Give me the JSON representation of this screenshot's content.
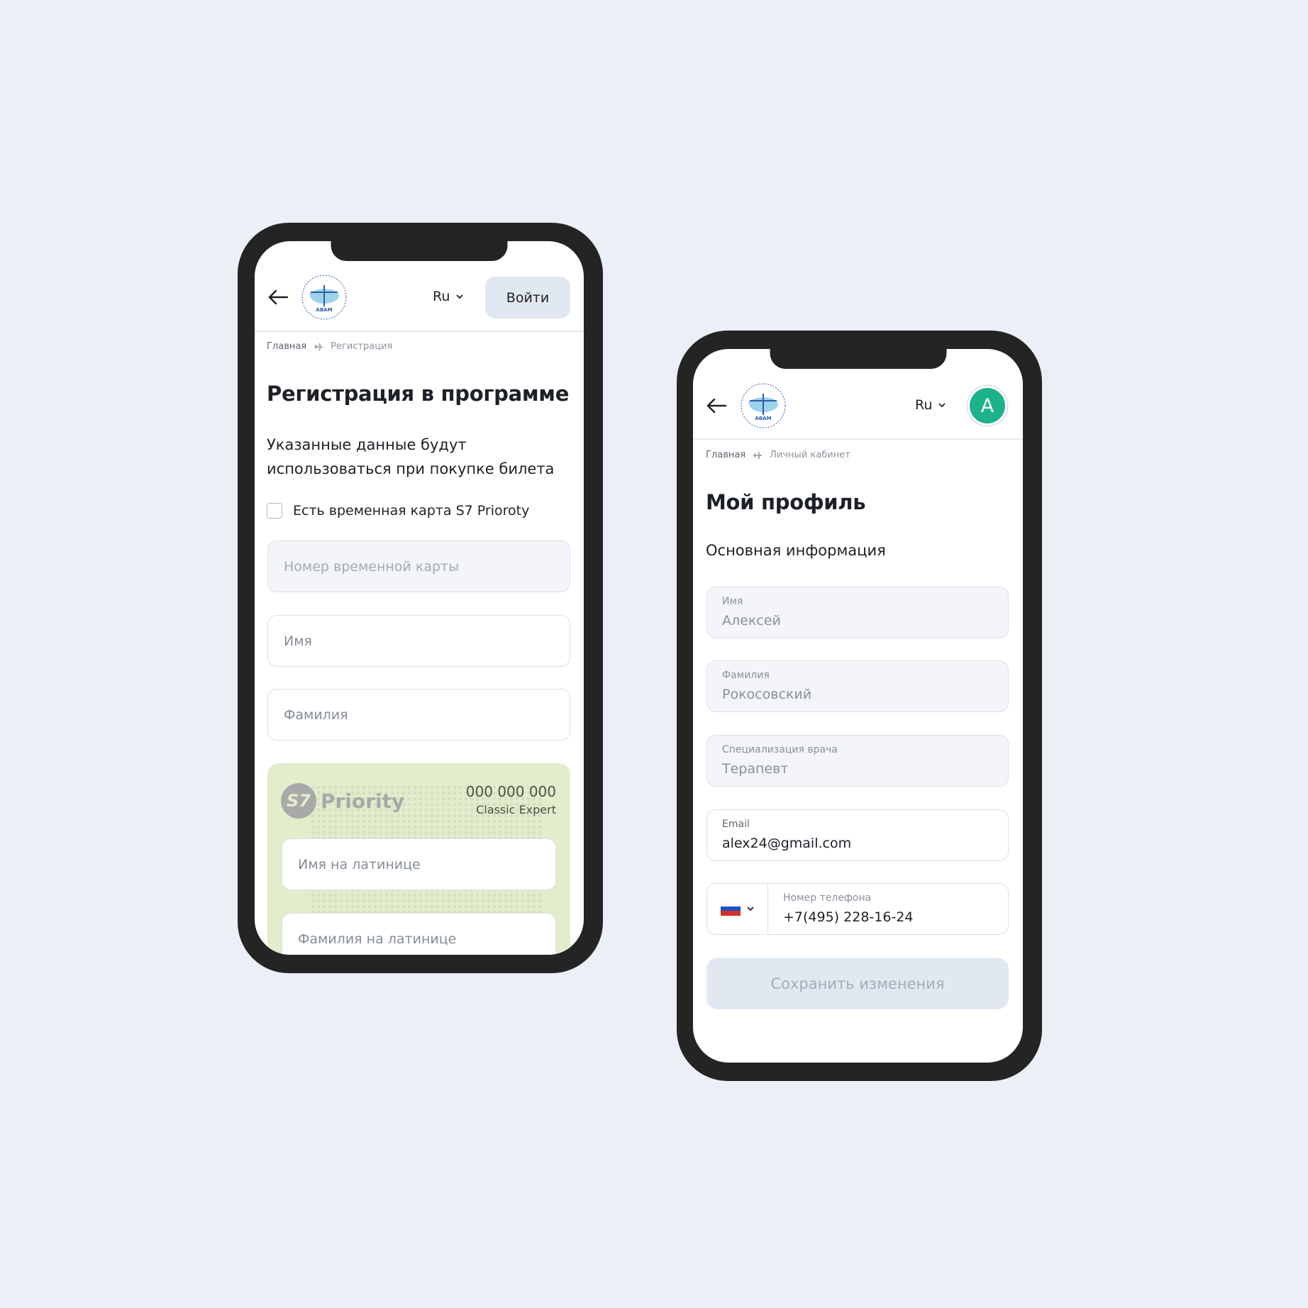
{
  "colors": {
    "background": "#ebeff6",
    "phone_frame": "#242424",
    "button_bg": "#e2e8f2",
    "avatar": "#1db38a",
    "card_bg": "#e2edcc"
  },
  "logo": {
    "text": "АВАМ",
    "ring_text": "АССОЦИАЦИЯ ВРАЧЕЙ АВИАЦИОННОЙ МЕДИЦИНЫ"
  },
  "registration": {
    "header": {
      "back_icon": "arrow-left-icon",
      "lang": "Ru",
      "login_label": "Войти"
    },
    "breadcrumb": {
      "home": "Главная",
      "separator_icon": "plane-icon",
      "current": "Регистрация"
    },
    "title": "Регистрация в программе",
    "subtitle_line1": "Указанные данные будут",
    "subtitle_line2": "использоваться при покупке билета",
    "checkbox": {
      "label": "Есть временная карта S7 Prioroty",
      "checked": false
    },
    "fields": {
      "temp_card": "Номер временной карты",
      "first_name": "Имя",
      "last_name": "Фамилия"
    },
    "card": {
      "brand_mark": "S7",
      "brand": "Priority",
      "number": "000 000 000",
      "tier": "Classic Expert",
      "latin_first": "Имя на латинице",
      "latin_last": "Фамилия на латинице"
    }
  },
  "profile": {
    "header": {
      "back_icon": "arrow-left-icon",
      "lang": "Ru",
      "avatar_letter": "A"
    },
    "breadcrumb": {
      "home": "Главная",
      "separator_icon": "plane-icon",
      "current": "Личный кабинет"
    },
    "title": "Мой профиль",
    "section": "Основная информация",
    "fields": [
      {
        "label": "Имя",
        "value": "Алексей"
      },
      {
        "label": "Фамилия",
        "value": "Рокосовский"
      },
      {
        "label": "Специализация врача",
        "value": "Терапевт"
      },
      {
        "label": "Email",
        "value": "alex24@gmail.com"
      }
    ],
    "phone": {
      "country_flag": "russia-flag-icon",
      "label": "Номер телефона",
      "value": "+7(495) 228-16-24"
    },
    "save_label": "Сохранить изменения"
  }
}
